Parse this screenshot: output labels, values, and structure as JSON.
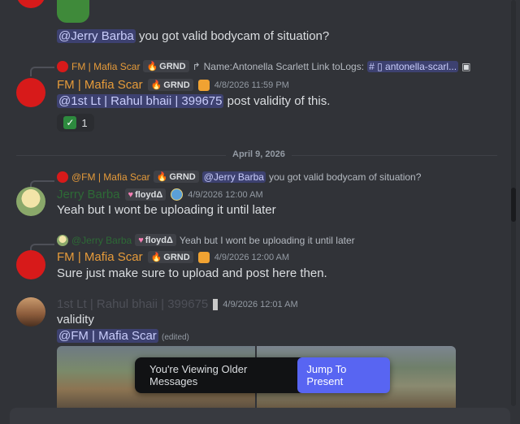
{
  "top": {
    "mention": "@Jerry Barba",
    "text": "you got valid bodycam of situation?"
  },
  "msg1": {
    "reply": {
      "name": "FM | Mafia Scar",
      "tag": "GRND",
      "text": "Name:Antonella Scarlett  Link toLogs:",
      "channel": "antonella-scarl..."
    },
    "name": "FM | Mafia Scar",
    "tag": "GRND",
    "timestamp": "4/8/2026 11:59 PM",
    "mention": "@1st Lt  | Rahul bhaii | 399675",
    "text": "post validity of this.",
    "reaction_count": "1"
  },
  "date_divider": "April 9, 2026",
  "msg2": {
    "reply": {
      "name": "@FM | Mafia Scar",
      "tag": "GRND",
      "mention": "@Jerry Barba",
      "text": "you got valid bodycam of situation?"
    },
    "name": "Jerry Barba",
    "tag": "floydΔ",
    "timestamp": "4/9/2026 12:00 AM",
    "text": "Yeah but I wont be uploading it until later"
  },
  "msg3": {
    "reply": {
      "name": "@Jerry Barba",
      "tag": "floydΔ",
      "text": "Yeah but I wont be uploading it until later"
    },
    "name": "FM | Mafia Scar",
    "tag": "GRND",
    "timestamp": "4/9/2026 12:00 AM",
    "text": "Sure just make sure to upload and post here then."
  },
  "msg4": {
    "name": "1st Lt  | Rahul bhaii | 399675",
    "timestamp": "4/9/2026 12:01 AM",
    "text": "validity",
    "mention": "@FM | Mafia Scar",
    "edited": "(edited)"
  },
  "banner": {
    "text": "You're Viewing Older Messages",
    "button": "Jump To Present"
  },
  "colors": {
    "background": "#313338",
    "accent": "#5865f2",
    "fm_name": "#e69b3a"
  }
}
